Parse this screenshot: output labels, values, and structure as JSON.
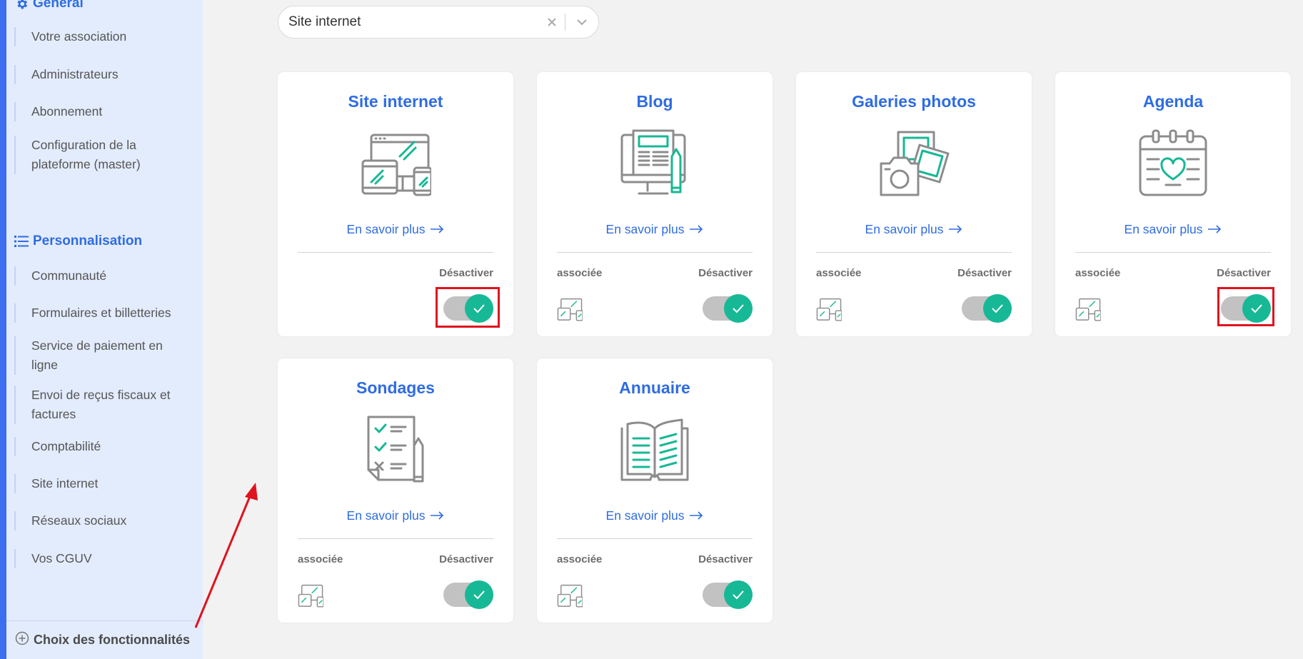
{
  "sidebar": {
    "general_heading": "Général",
    "general_items": [
      {
        "label": "Votre association"
      },
      {
        "label": "Administrateurs"
      },
      {
        "label": "Abonnement"
      },
      {
        "label": "Configuration de la plateforme (master)"
      }
    ],
    "perso_heading": "Personnalisation",
    "perso_items": [
      {
        "label": "Communauté"
      },
      {
        "label": "Formulaires et billetteries"
      },
      {
        "label": "Service de paiement en ligne"
      },
      {
        "label": "Envoi de reçus fiscaux et factures"
      },
      {
        "label": "Comptabilité"
      },
      {
        "label": "Site internet"
      },
      {
        "label": "Réseaux sociaux"
      },
      {
        "label": "Vos CGUV"
      }
    ],
    "footer_label": "Choix des fonctionnalités"
  },
  "filter": {
    "value": "Site internet"
  },
  "cards": [
    {
      "title": "Site internet",
      "link": "En savoir plus",
      "assoc": "",
      "toggle_label": "Désactiver",
      "enabled": true,
      "illustration": "devices-icon"
    },
    {
      "title": "Blog",
      "link": "En savoir plus",
      "assoc": "associée",
      "toggle_label": "Désactiver",
      "enabled": true,
      "illustration": "blog-icon"
    },
    {
      "title": "Galeries photos",
      "link": "En savoir plus",
      "assoc": "associée",
      "toggle_label": "Désactiver",
      "enabled": true,
      "illustration": "camera-photos-icon"
    },
    {
      "title": "Agenda",
      "link": "En savoir plus",
      "assoc": "associée",
      "toggle_label": "Désactiver",
      "enabled": true,
      "illustration": "calendar-heart-icon"
    },
    {
      "title": "Sondages",
      "link": "En savoir plus",
      "assoc": "associée",
      "toggle_label": "Désactiver",
      "enabled": true,
      "illustration": "survey-checklist-icon"
    },
    {
      "title": "Annuaire",
      "link": "En savoir plus",
      "assoc": "associée",
      "toggle_label": "Désactiver",
      "enabled": true,
      "illustration": "open-book-icon"
    }
  ],
  "colors": {
    "accent": "#2f6ce0",
    "teal": "#17b895",
    "toggle_track": "#c2c2c2",
    "sidebar_bg": "#e3ecfd",
    "annotation_red": "#e0121f"
  }
}
